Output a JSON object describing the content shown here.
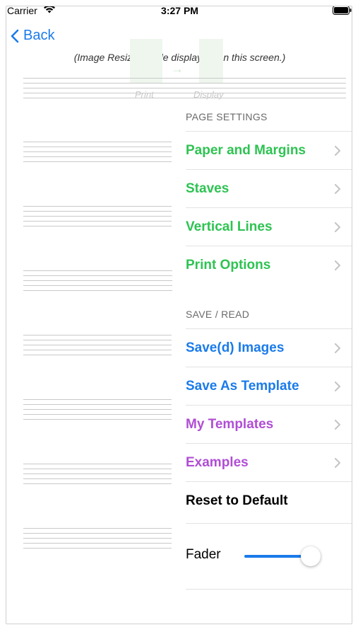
{
  "status_bar": {
    "carrier": "Carrier",
    "time": "3:27 PM"
  },
  "nav": {
    "back_label": "Back"
  },
  "caption": "(Image Resized while displaying on this screen.)",
  "background": {
    "print_label": "Print",
    "display_label": "Display"
  },
  "menu": {
    "page_settings": {
      "header": "PAGE SETTINGS",
      "items": [
        {
          "label": "Paper and Margins",
          "color": "#2ec352"
        },
        {
          "label": "Staves",
          "color": "#2ec352"
        },
        {
          "label": "Vertical Lines",
          "color": "#2ec352"
        },
        {
          "label": "Print Options",
          "color": "#2ec352"
        }
      ]
    },
    "save_read": {
      "header": "SAVE / READ",
      "items": [
        {
          "label": "Save(d) Images",
          "color": "#1a7bea"
        },
        {
          "label": "Save As Template",
          "color": "#1a7bea"
        },
        {
          "label": "My Templates",
          "color": "#b04ed4"
        },
        {
          "label": "Examples",
          "color": "#b04ed4"
        },
        {
          "label": "Reset to Default",
          "color": "#000000"
        }
      ]
    },
    "fader": {
      "label": "Fader",
      "value": 0.9
    }
  },
  "colors": {
    "accent": "#1a7bea",
    "green": "#2ec352",
    "purple": "#b04ed4"
  }
}
